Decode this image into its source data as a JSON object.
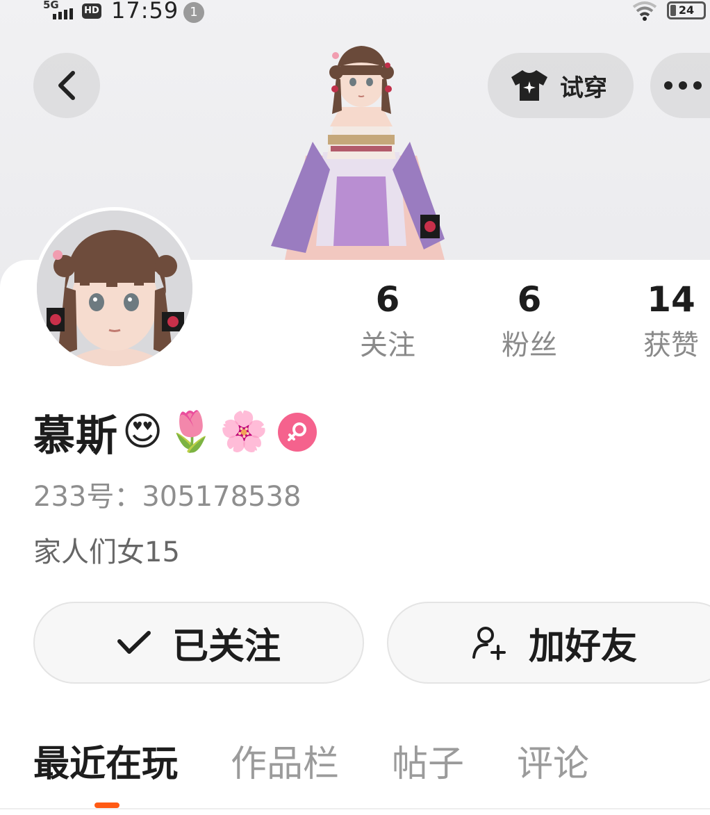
{
  "status_bar": {
    "network": "5G",
    "hd": "HD",
    "time": "17:59",
    "notification_count": "1",
    "battery": "24"
  },
  "header": {
    "back_icon": "chevron-left-icon",
    "tryon_label": "试穿",
    "tryon_icon": "tshirt-icon",
    "more_icon": "more-horizontal-icon"
  },
  "stats": [
    {
      "value": "6",
      "label": "关注"
    },
    {
      "value": "6",
      "label": "粉丝"
    },
    {
      "value": "14",
      "label": "获赞"
    }
  ],
  "profile": {
    "name": "慕斯",
    "emojis": [
      "😍",
      "🌷",
      "🌸"
    ],
    "gender_icon": "female-icon",
    "uid": "233号：305178538",
    "bio": "家人们女15"
  },
  "actions": {
    "follow_label": "已关注",
    "add_friend_label": "加好友"
  },
  "tabs": [
    {
      "label": "最近在玩",
      "active": true
    },
    {
      "label": "作品栏",
      "active": false
    },
    {
      "label": "帖子",
      "active": false
    },
    {
      "label": "评论",
      "active": false
    }
  ],
  "colors": {
    "accent": "#ff5a14",
    "gender": "#f5628d"
  }
}
